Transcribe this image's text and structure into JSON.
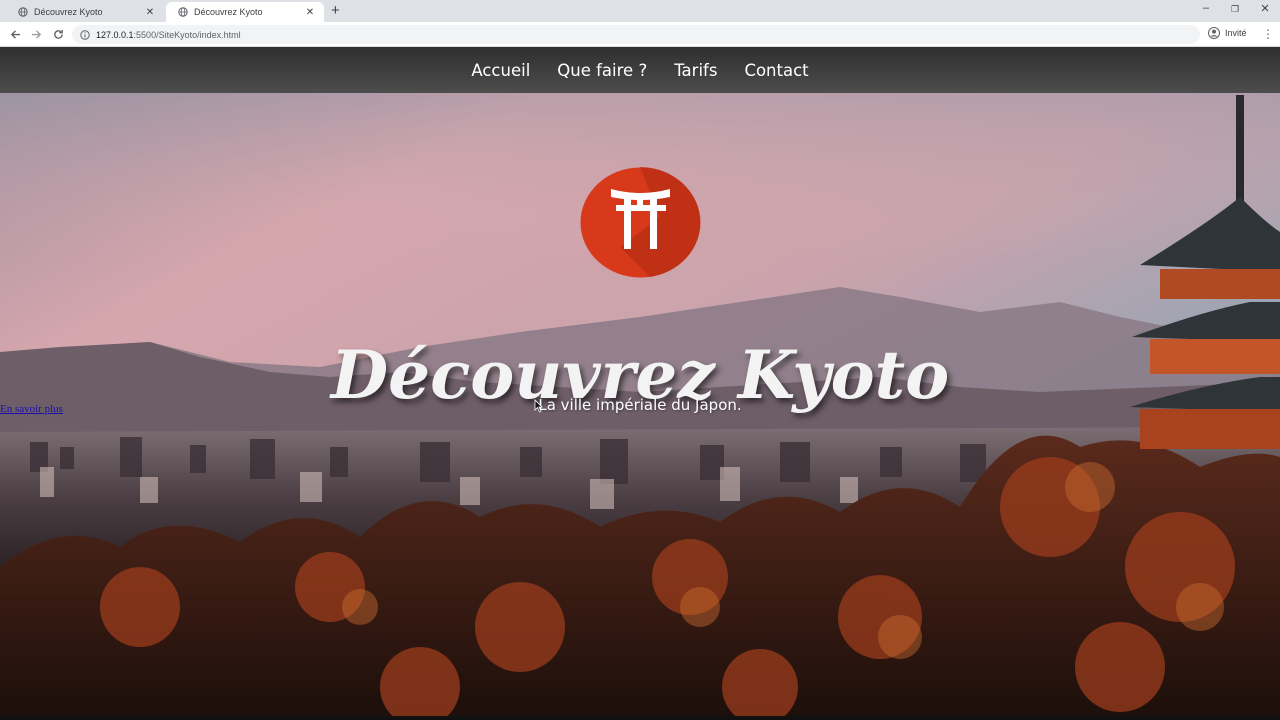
{
  "browser": {
    "tabs": [
      {
        "title": "Découvrez Kyoto",
        "active": false
      },
      {
        "title": "Découvrez Kyoto",
        "active": true
      }
    ],
    "new_tab_icon": "plus-icon",
    "window_controls": {
      "minimize": "–",
      "restore": "❐",
      "close": "✕"
    },
    "url_host": "127.0.0.1",
    "url_path": ":5500/SiteKyoto/index.html",
    "profile_label": "Invité"
  },
  "site": {
    "nav": [
      "Accueil",
      "Que faire ?",
      "Tarifs",
      "Contact"
    ],
    "logo_icon": "torii-gate-icon",
    "logo_color": "#d8391b",
    "title": "Découvrez Kyoto",
    "subtitle": "La ville impériale du Japon.",
    "learn_more_link": "En savoir plus"
  }
}
